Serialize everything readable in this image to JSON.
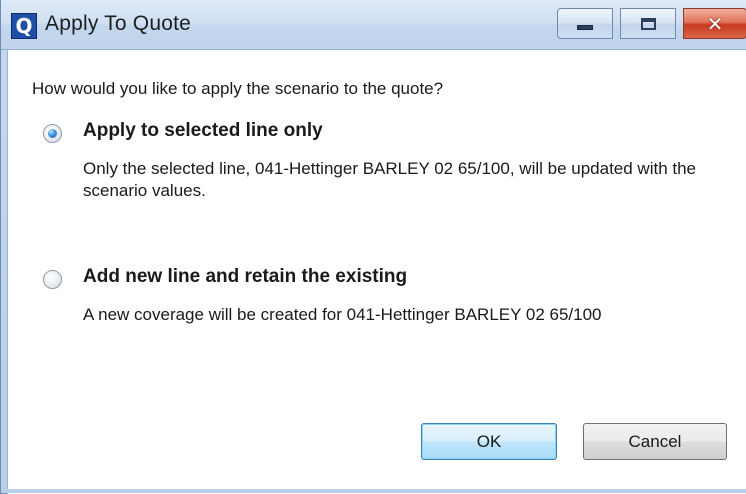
{
  "window": {
    "title": "Apply To Quote",
    "app_icon_letter": "Q",
    "close_glyph": "✕",
    "accent_color": "#1f4ea7"
  },
  "dialog": {
    "question": "How would you like to apply the scenario to the quote?",
    "options": [
      {
        "label": "Apply to selected line only",
        "description": "Only the selected line, 041-Hettinger BARLEY 02 65/100, will be updated with the scenario values.",
        "selected": true
      },
      {
        "label": "Add new line and retain the existing",
        "description": "A new coverage will be created for 041-Hettinger BARLEY 02 65/100",
        "selected": false
      }
    ],
    "buttons": {
      "ok": "OK",
      "cancel": "Cancel"
    }
  },
  "icons": {
    "app": "q-app-icon",
    "minimize": "minimize-icon",
    "maximize": "maximize-icon",
    "close": "close-icon",
    "radio_checked": "radio-checked-icon",
    "radio_unchecked": "radio-unchecked-icon"
  }
}
